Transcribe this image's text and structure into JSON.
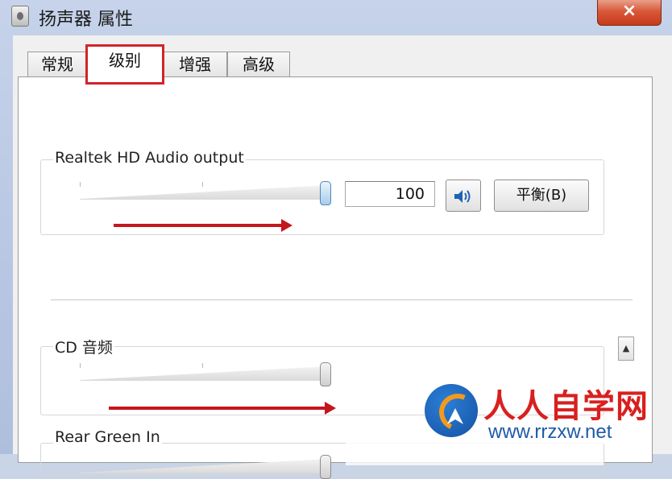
{
  "window": {
    "title": "扬声器 属性",
    "close_label": "×"
  },
  "tabs": [
    {
      "label": "常规"
    },
    {
      "label": "级别"
    },
    {
      "label": "增强"
    },
    {
      "label": "高级"
    }
  ],
  "active_tab": "级别",
  "devices": [
    {
      "name": "Realtek HD Audio output",
      "value": "100",
      "level_percent": 100,
      "balance_label": "平衡(B)"
    },
    {
      "name": "CD 音频",
      "level_percent": 100
    },
    {
      "name": "Rear Green In",
      "level_percent": 100
    }
  ],
  "icons": {
    "mute": "speaker-icon",
    "scroll_up": "arrow-up-icon"
  },
  "annotation_color": "#d4232a",
  "watermark": {
    "main": "人人自学网",
    "sub": "www.rrzxw.net"
  }
}
